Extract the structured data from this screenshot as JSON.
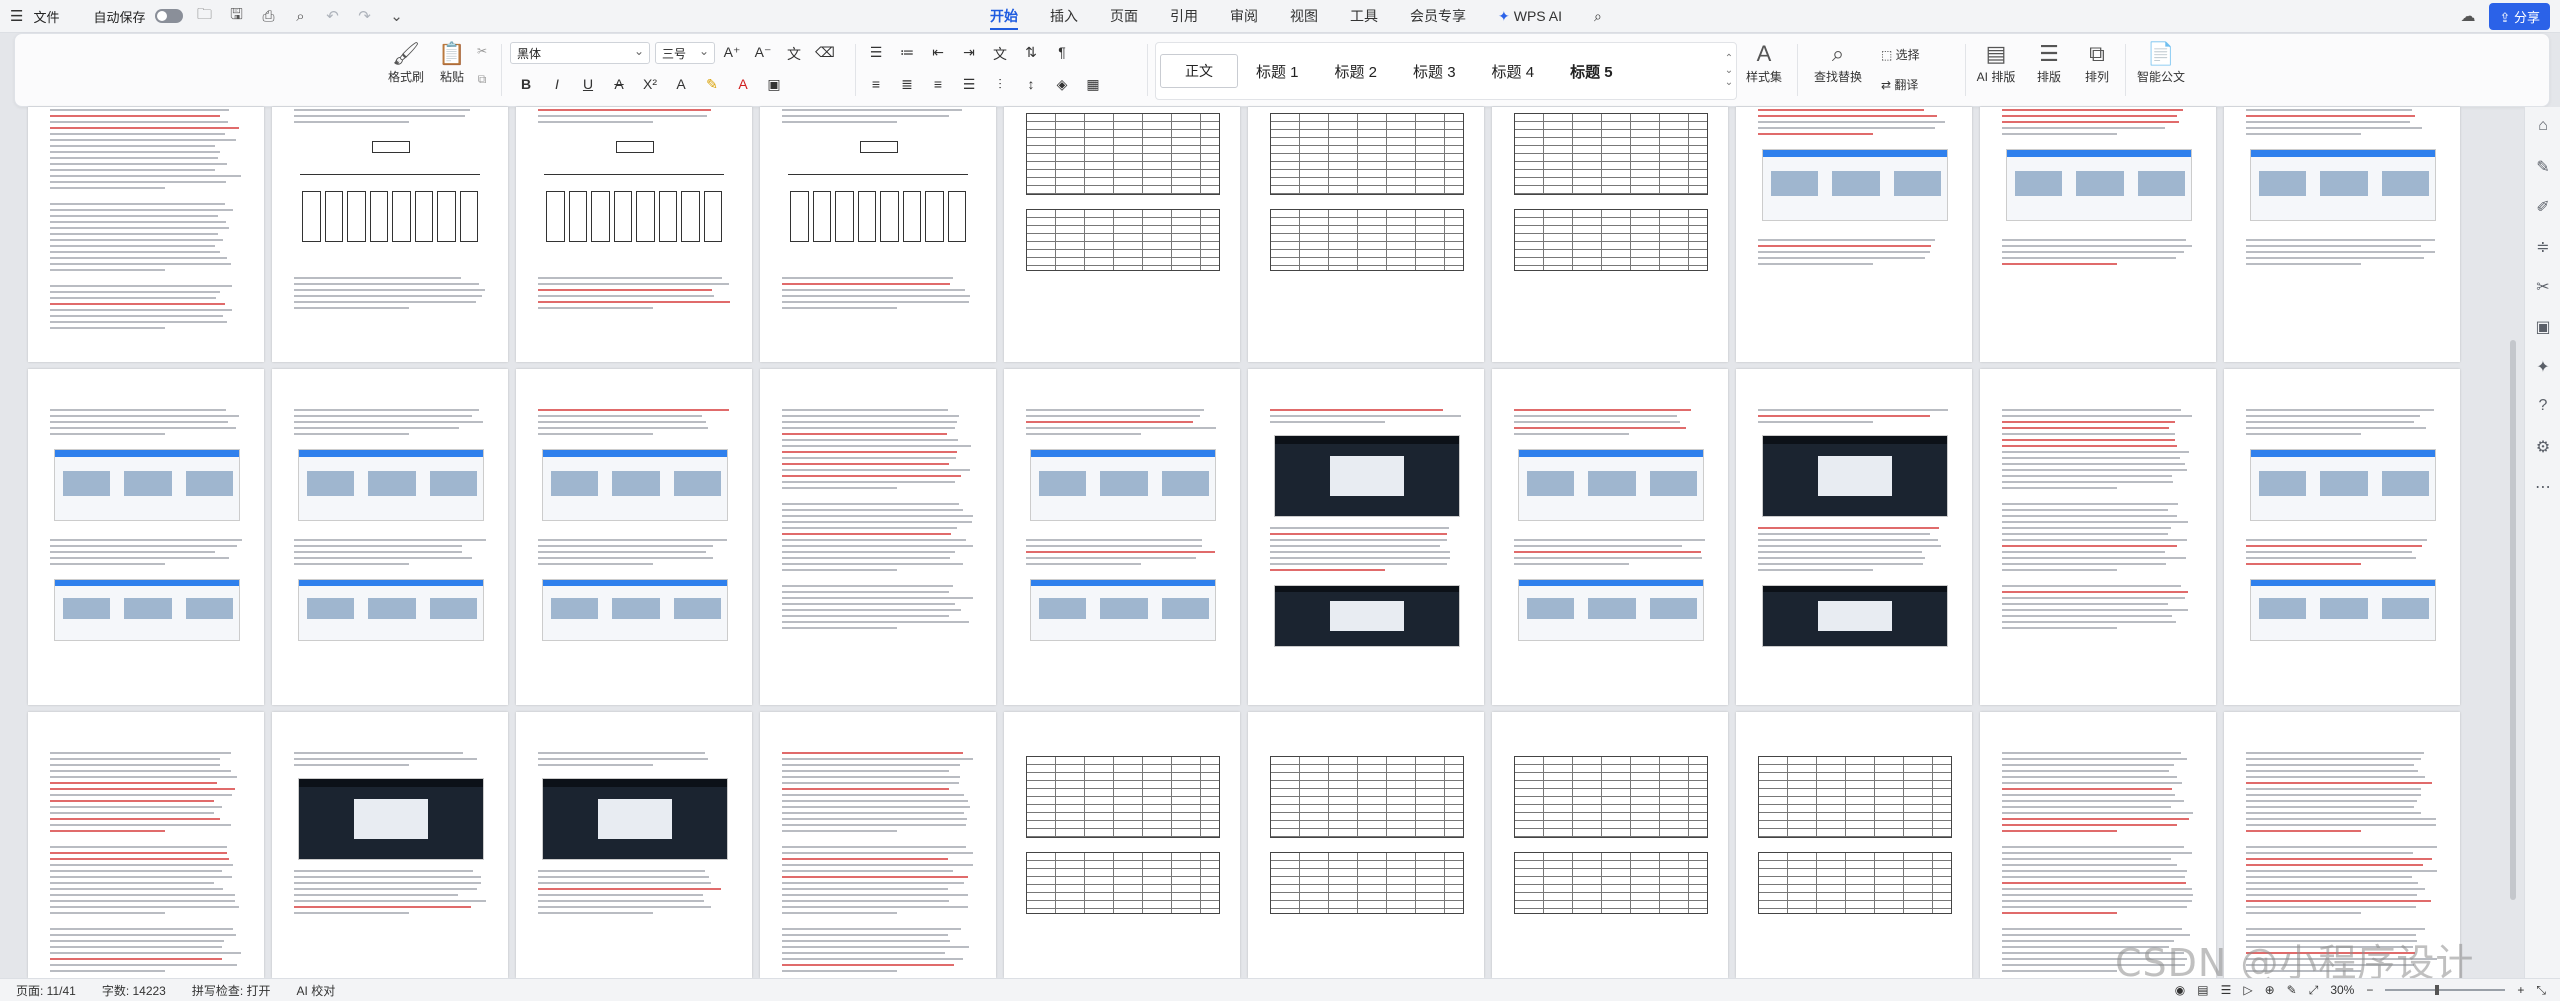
{
  "menubar": {
    "file_label": "文件",
    "autosave_label": "自动保存",
    "tabs": [
      {
        "label": "开始",
        "active": true
      },
      {
        "label": "插入",
        "active": false
      },
      {
        "label": "页面",
        "active": false
      },
      {
        "label": "引用",
        "active": false
      },
      {
        "label": "审阅",
        "active": false
      },
      {
        "label": "视图",
        "active": false
      },
      {
        "label": "工具",
        "active": false
      },
      {
        "label": "会员专享",
        "active": false
      },
      {
        "label": "WPS AI",
        "active": false
      }
    ],
    "share_label": "分享"
  },
  "ribbon": {
    "format_painter": "格式刷",
    "paste": "粘贴",
    "font_name": "黑体",
    "font_size": "三号",
    "styles": [
      {
        "label": "正文",
        "current": true,
        "bold": false
      },
      {
        "label": "标题 1",
        "current": false,
        "bold": false
      },
      {
        "label": "标题 2",
        "current": false,
        "bold": false
      },
      {
        "label": "标题 3",
        "current": false,
        "bold": false
      },
      {
        "label": "标题 4",
        "current": false,
        "bold": false
      },
      {
        "label": "标题 5",
        "current": false,
        "bold": true
      }
    ],
    "style_set": "样式集",
    "find_replace": "查找替换",
    "select": "选择",
    "translate": "翻译",
    "ai_layout": "AI 排版",
    "layout": "排版",
    "arrange": "排列",
    "smart_doc": "智能公文"
  },
  "statusbar": {
    "page": "页面: 11/41",
    "word_count": "字数: 14223",
    "spell_check": "拼写检查: 打开",
    "ai_proof": "AI 校对",
    "zoom": "30%"
  },
  "watermark": "CSDN @小程序设计",
  "colors": {
    "accent": "#1f5ce0",
    "share": "#2b62e8",
    "canvas": "#e4e6ea"
  }
}
